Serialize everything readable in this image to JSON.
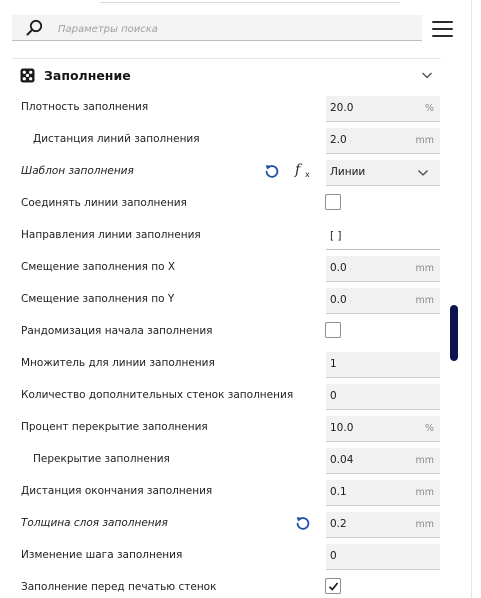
{
  "search": {
    "placeholder": "Параметры поиска",
    "value": ""
  },
  "section": {
    "title": "Заполнение"
  },
  "settings": [
    {
      "label": "Плотность заполнения",
      "value": "20.0",
      "unit": "%"
    },
    {
      "label": "Дистанция линий заполнения",
      "value": "2.0",
      "unit": "mm"
    },
    {
      "label": "Шаблон заполнения",
      "value": "Линии"
    },
    {
      "label": "Соединять линии заполнения",
      "checked": false
    },
    {
      "label": "Направления линии заполнения",
      "value": "[ ]"
    },
    {
      "label": "Смещение заполнения по X",
      "value": "0.0",
      "unit": "mm"
    },
    {
      "label": "Смещение заполнения по Y",
      "value": "0.0",
      "unit": "mm"
    },
    {
      "label": "Рандомизация начала заполнения",
      "checked": false
    },
    {
      "label": "Множитель для линии заполнения",
      "value": "1"
    },
    {
      "label": "Количество дополнительных стенок заполнения",
      "value": "0"
    },
    {
      "label": "Процент перекрытие заполнения",
      "value": "10.0",
      "unit": "%"
    },
    {
      "label": "Перекрытие заполнения",
      "value": "0.04",
      "unit": "mm"
    },
    {
      "label": "Дистанция окончания заполнения",
      "value": "0.1",
      "unit": "mm"
    },
    {
      "label": "Толщина слоя заполнения",
      "value": "0.2",
      "unit": "mm"
    },
    {
      "label": "Изменение шага заполнения",
      "value": "0"
    },
    {
      "label": "Заполнение перед печатью стенок",
      "checked": true
    }
  ],
  "colors": {
    "accent": "#1e4fa8",
    "scrollbar": "#0e1450",
    "field_bg": "#f1f1f1"
  },
  "icons": {
    "search": "search-icon",
    "menu": "hamburger-menu-icon",
    "section": "infill-icon",
    "collapse": "chevron-down-icon",
    "reset": "reset-icon",
    "function": "fx-icon"
  }
}
